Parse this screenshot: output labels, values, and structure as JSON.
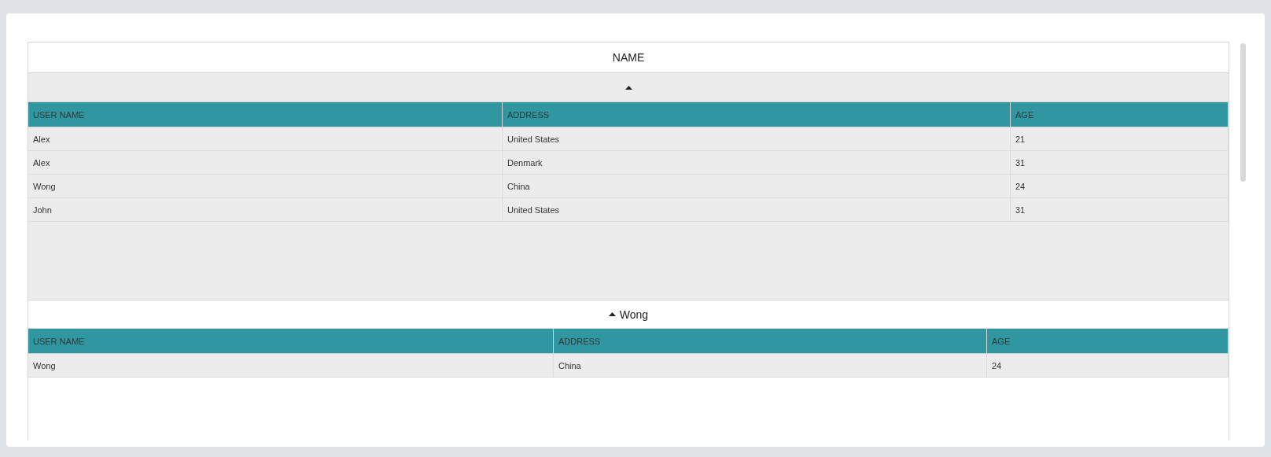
{
  "header": {
    "title": "NAME"
  },
  "groups": [
    {
      "expanded": true,
      "columns": [
        "USER NAME",
        "ADDRESS",
        "AGE"
      ],
      "rows": [
        [
          "Alex",
          "United States",
          "21"
        ],
        [
          "Alex",
          "Denmark",
          "31"
        ],
        [
          "Wong",
          "China",
          "24"
        ],
        [
          "John",
          "United States",
          "31"
        ]
      ]
    },
    {
      "label": "Wong",
      "expanded": true,
      "columns": [
        "USER NAME",
        "ADDRESS",
        "AGE"
      ],
      "rows": [
        [
          "Wong",
          "China",
          "24"
        ]
      ]
    }
  ]
}
